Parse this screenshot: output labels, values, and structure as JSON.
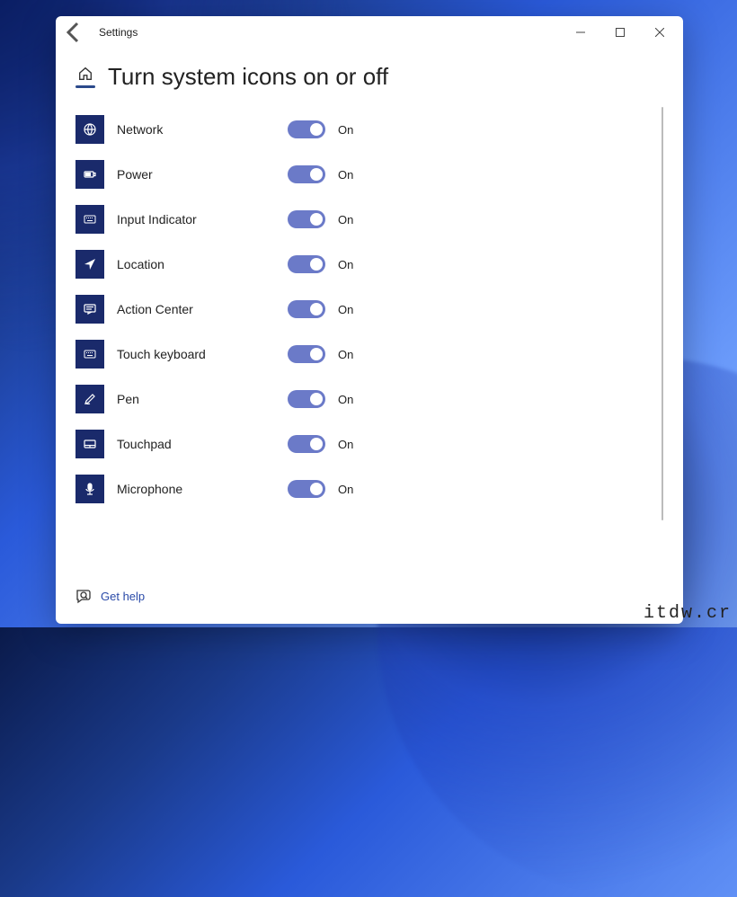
{
  "titlebar": {
    "app_title": "Settings"
  },
  "page": {
    "title": "Turn system icons on or off"
  },
  "items": [
    {
      "icon": "network",
      "label": "Network",
      "state": "On"
    },
    {
      "icon": "power",
      "label": "Power",
      "state": "On"
    },
    {
      "icon": "input",
      "label": "Input Indicator",
      "state": "On"
    },
    {
      "icon": "location",
      "label": "Location",
      "state": "On"
    },
    {
      "icon": "actioncenter",
      "label": "Action Center",
      "state": "On"
    },
    {
      "icon": "touchkeyboard",
      "label": "Touch keyboard",
      "state": "On"
    },
    {
      "icon": "pen",
      "label": "Pen",
      "state": "On"
    },
    {
      "icon": "touchpad",
      "label": "Touchpad",
      "state": "On"
    },
    {
      "icon": "microphone",
      "label": "Microphone",
      "state": "On"
    }
  ],
  "footer": {
    "help_label": "Get help"
  },
  "watermark": "itdw.cr"
}
